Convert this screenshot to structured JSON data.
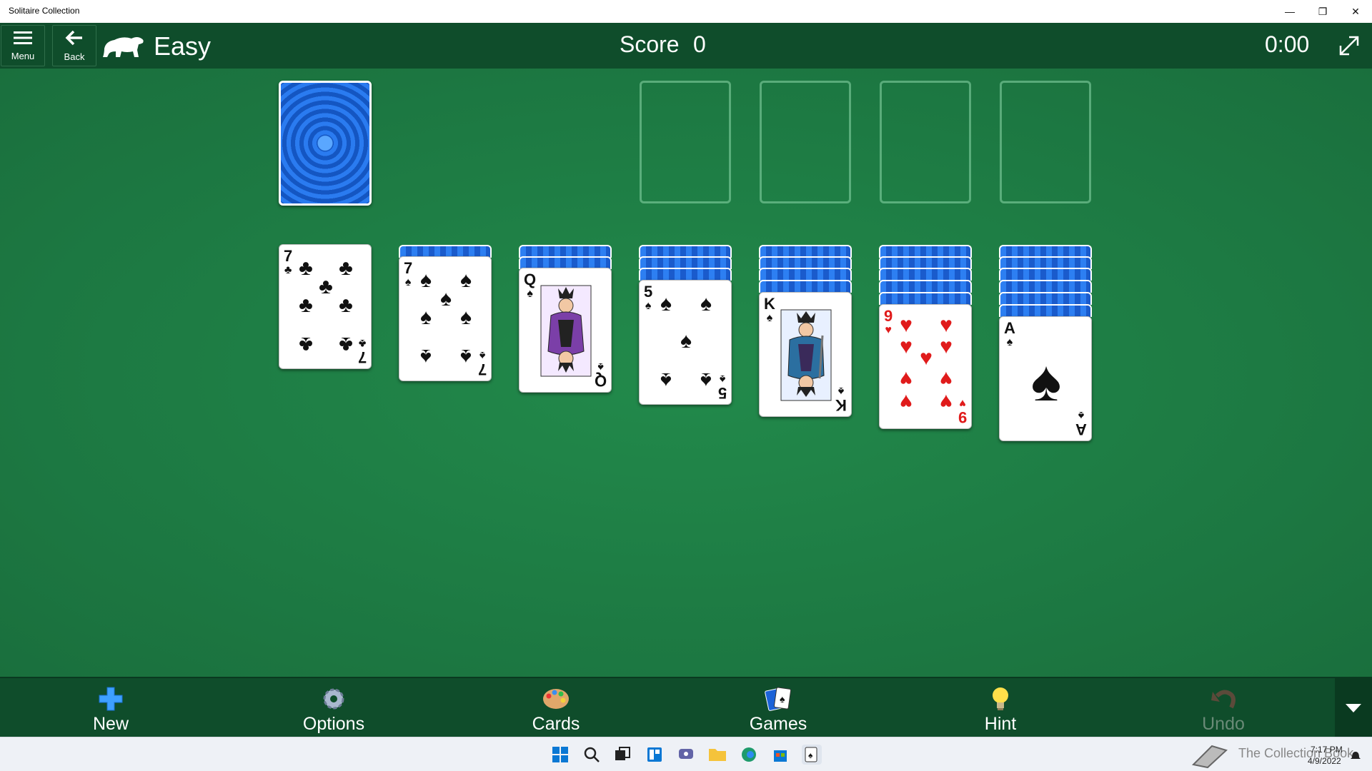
{
  "window": {
    "title": "Solitaire Collection",
    "minimize_glyph": "—",
    "restore_glyph": "❐",
    "close_glyph": "✕"
  },
  "header": {
    "menu_label": "Menu",
    "back_label": "Back",
    "difficulty": "Easy",
    "score_label": "Score",
    "score_value": "0",
    "timer": "0:00"
  },
  "stock": {
    "face_down": true
  },
  "foundations": [
    {
      "empty": true
    },
    {
      "empty": true
    },
    {
      "empty": true
    },
    {
      "empty": true
    }
  ],
  "tableau": [
    {
      "hidden": 0,
      "rank": "7",
      "suit": "♣",
      "color": "black"
    },
    {
      "hidden": 1,
      "rank": "7",
      "suit": "♠",
      "color": "black"
    },
    {
      "hidden": 2,
      "rank": "Q",
      "suit": "♠",
      "color": "black"
    },
    {
      "hidden": 3,
      "rank": "5",
      "suit": "♠",
      "color": "black"
    },
    {
      "hidden": 4,
      "rank": "K",
      "suit": "♠",
      "color": "black"
    },
    {
      "hidden": 5,
      "rank": "9",
      "suit": "♥",
      "color": "red"
    },
    {
      "hidden": 6,
      "rank": "A",
      "suit": "♠",
      "color": "black"
    }
  ],
  "toolbar": {
    "new_label": "New",
    "options_label": "Options",
    "cards_label": "Cards",
    "games_label": "Games",
    "hint_label": "Hint",
    "undo_label": "Undo",
    "undo_enabled": false
  },
  "taskbar": {
    "icons": [
      "windows-start-icon",
      "search-icon",
      "task-view-icon",
      "widgets-icon",
      "chat-icon",
      "file-explorer-icon",
      "edge-icon",
      "store-icon",
      "solitaire-icon"
    ],
    "watermark": "The Collection Book",
    "time": "7:17 PM",
    "date": "4/9/2022"
  },
  "colors": {
    "felt": "#1d7a43",
    "bars": "#0f4d2b",
    "card_back": "#1c63d8",
    "red_suit": "#e01b1b"
  }
}
